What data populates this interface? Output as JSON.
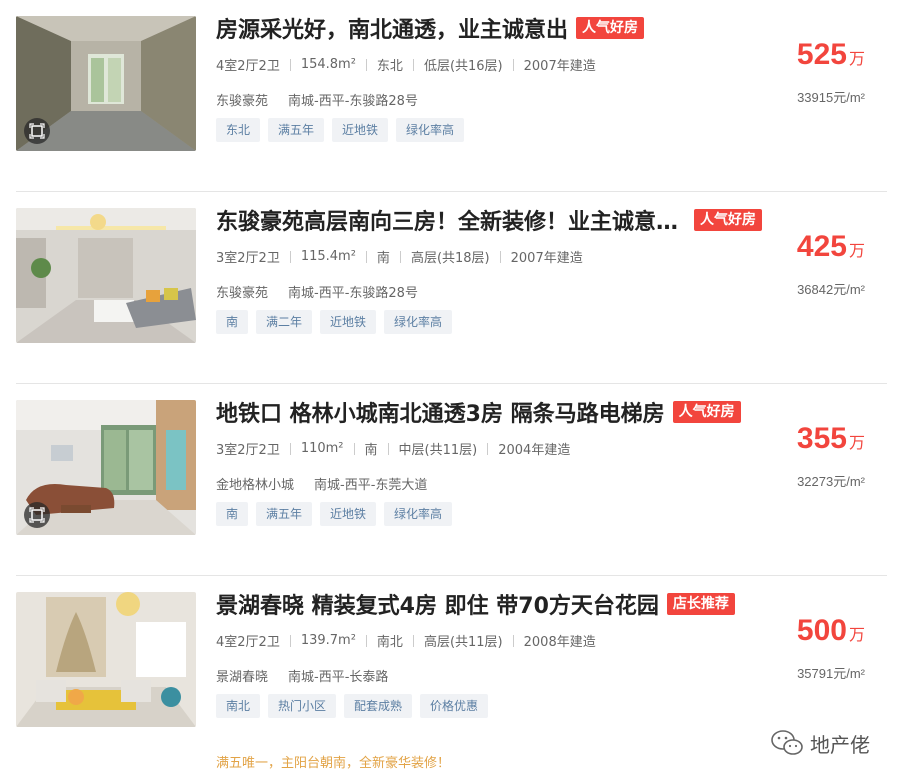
{
  "listings": [
    {
      "title": "房源采光好，南北通透，业主诚意出",
      "badge": "人气好房",
      "layout": "4室2厅2卫",
      "area": "154.8m²",
      "orientation": "东北",
      "floor": "低层(共16层)",
      "year": "2007年建造",
      "community": "东骏豪苑",
      "address": "南城-西平-东骏路28号",
      "tags": [
        "东北",
        "满五年",
        "近地铁",
        "绿化率高"
      ],
      "price": "525",
      "price_unit": "万",
      "unit_price": "33915元/m²"
    },
    {
      "title": "东骏豪苑高层南向三房！全新装修！业主诚意出售",
      "badge": "人气好房",
      "layout": "3室2厅2卫",
      "area": "115.4m²",
      "orientation": "南",
      "floor": "高层(共18层)",
      "year": "2007年建造",
      "community": "东骏豪苑",
      "address": "南城-西平-东骏路28号",
      "tags": [
        "南",
        "满二年",
        "近地铁",
        "绿化率高"
      ],
      "price": "425",
      "price_unit": "万",
      "unit_price": "36842元/m²"
    },
    {
      "title": "地铁口 格林小城南北通透3房 隔条马路电梯房",
      "badge": "人气好房",
      "layout": "3室2厅2卫",
      "area": "110m²",
      "orientation": "南",
      "floor": "中层(共11层)",
      "year": "2004年建造",
      "community": "金地格林小城",
      "address": "南城-西平-东莞大道",
      "tags": [
        "南",
        "满五年",
        "近地铁",
        "绿化率高"
      ],
      "price": "355",
      "price_unit": "万",
      "unit_price": "32273元/m²"
    },
    {
      "title": "景湖春晓 精装复式4房 即住 带70方天台花园",
      "badge": "店长推荐",
      "layout": "4室2厅2卫",
      "area": "139.7m²",
      "orientation": "南北",
      "floor": "高层(共11层)",
      "year": "2008年建造",
      "community": "景湖春晓",
      "address": "南城-西平-长泰路",
      "tags": [
        "南北",
        "热门小区",
        "配套成熟",
        "价格优惠"
      ],
      "price": "500",
      "price_unit": "万",
      "unit_price": "35791元/m²"
    }
  ],
  "footer_note": "满五唯一，主阳台朝南，全新豪华装修！",
  "watermark": "地产佬",
  "colors": {
    "accent": "#f2453d",
    "tag_text": "#5c7fa3",
    "tag_bg": "#f0f2f5",
    "note": "#e2a346"
  }
}
